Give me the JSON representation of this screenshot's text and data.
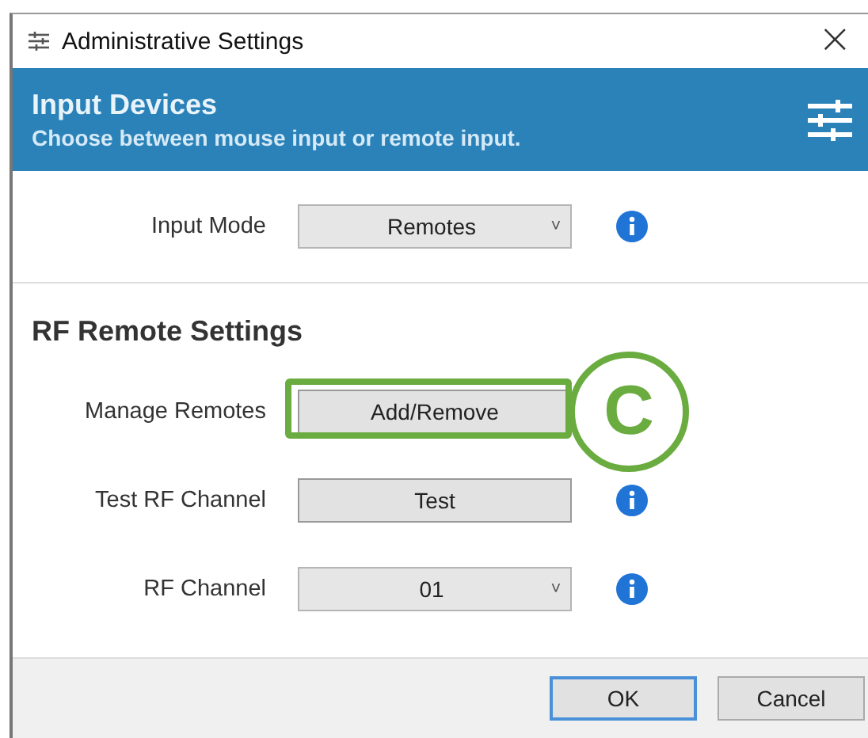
{
  "window": {
    "title": "Administrative Settings",
    "close": "×"
  },
  "header": {
    "title": "Input Devices",
    "subtitle": "Choose between mouse input or remote input."
  },
  "input_mode": {
    "label": "Input Mode",
    "kind": "dropdown",
    "value": "Remotes",
    "caret": "˅",
    "info": true
  },
  "rf_section": {
    "heading": "RF Remote Settings",
    "rows": [
      {
        "label": "Manage Remotes",
        "kind": "button",
        "value": "Add/Remove",
        "info": false,
        "callout": "C"
      },
      {
        "label": "Test RF Channel",
        "kind": "button",
        "value": "Test",
        "info": true
      },
      {
        "label": "RF Channel",
        "kind": "dropdown",
        "value": "01",
        "caret": "˅",
        "info": true
      }
    ]
  },
  "buttons": [
    {
      "label": "OK",
      "default": true
    },
    {
      "label": "Cancel",
      "default": false
    }
  ]
}
